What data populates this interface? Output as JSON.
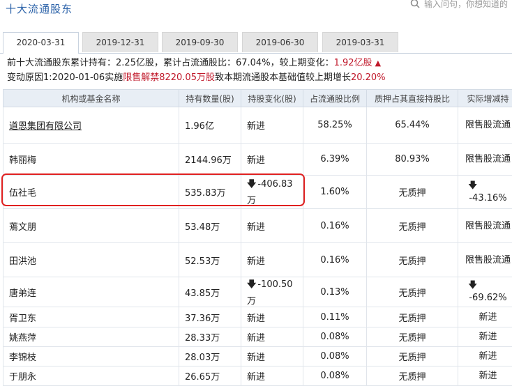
{
  "section_title": "十大流通股东",
  "search": {
    "placeholder": "输入问句，你想知道的"
  },
  "tabs": [
    {
      "label": "2020-03-31",
      "active": true
    },
    {
      "label": "2019-12-31",
      "active": false
    },
    {
      "label": "2019-09-30",
      "active": false
    },
    {
      "label": "2019-06-30",
      "active": false
    },
    {
      "label": "2019-03-31",
      "active": false
    }
  ],
  "summary": {
    "line1_prefix": "前十大流通股东累计持有：",
    "total_shares": "2.25亿股",
    "ratio_label": "，累计占流通股比：",
    "ratio": "67.04%",
    "change_label": "，较上期变化：",
    "change_value": "1.92亿股",
    "line2_prefix": "变动原因1:2020-01-06实施",
    "line2_highlight1": "限售解禁8220.05万股",
    "line2_middle": "致本期流通股本基础值较上期增长",
    "line2_highlight2": "20.20%"
  },
  "table": {
    "headers": [
      "机构或基金名称",
      "持有数量(股)",
      "持股变化(股)",
      "占流通股比例",
      "质押占其直接持股比",
      "实际增减持"
    ],
    "rows": [
      {
        "name": "道恩集团有限公司",
        "shares": "1.96亿",
        "change": "新进",
        "ratio": "58.25%",
        "pledge": "65.44%",
        "actual": "限售股流通"
      },
      {
        "name": "韩丽梅",
        "shares": "2144.96万",
        "change": "新进",
        "ratio": "6.39%",
        "pledge": "80.93%",
        "actual": "限售股流通"
      },
      {
        "name": "伍社毛",
        "shares": "535.83万",
        "change": "-406.83万",
        "ratio": "1.60%",
        "pledge": "无质押",
        "actual": "-43.16%"
      },
      {
        "name": "蔫文朋",
        "shares": "53.48万",
        "change": "新进",
        "ratio": "0.16%",
        "pledge": "无质押",
        "actual": "限售股流通"
      },
      {
        "name": "田洪池",
        "shares": "52.53万",
        "change": "新进",
        "ratio": "0.16%",
        "pledge": "无质押",
        "actual": "限售股流通"
      },
      {
        "name": "唐弟连",
        "shares": "43.85万",
        "change": "-100.50万",
        "ratio": "0.13%",
        "pledge": "无质押",
        "actual": "-69.62%"
      },
      {
        "name": "胥卫东",
        "shares": "37.36万",
        "change": "新进",
        "ratio": "0.11%",
        "pledge": "无质押",
        "actual": "新进"
      },
      {
        "name": "姚燕萍",
        "shares": "28.33万",
        "change": "新进",
        "ratio": "0.08%",
        "pledge": "无质押",
        "actual": "新进"
      },
      {
        "name": "李锦枝",
        "shares": "28.03万",
        "change": "新进",
        "ratio": "0.08%",
        "pledge": "无质押",
        "actual": "新进"
      },
      {
        "name": "于朋永",
        "shares": "26.65万",
        "change": "新进",
        "ratio": "0.08%",
        "pledge": "无质押",
        "actual": "新进"
      }
    ]
  }
}
